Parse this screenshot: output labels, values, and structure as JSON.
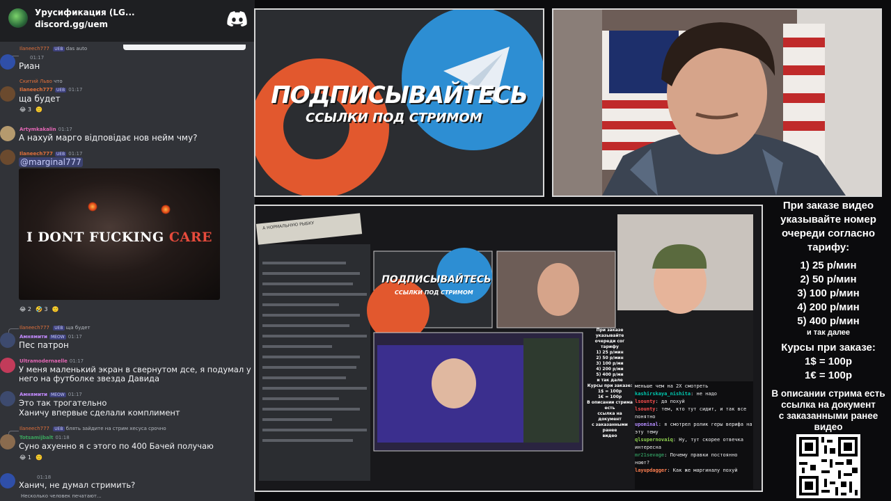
{
  "chat": {
    "server_name": "Урусификация (LG...",
    "server_invite": "discord.gg/uem",
    "typing": "Несколько человек печатают...",
    "messages": [
      {
        "reply_user": "Ilaneech777",
        "reply_badge": "UEB",
        "reply_text": "das auto",
        "user": "",
        "time": "01:17",
        "text": "Риан",
        "reactions": []
      },
      {
        "reply_user": "Скитий Льво",
        "reply_badge": "",
        "reply_text": "что",
        "user": "Ilaneech777",
        "user_color": "#e2703a",
        "badge": "UEB",
        "time": "01:17",
        "text": "ща будет",
        "reactions": [
          "😂 3",
          "🙂"
        ]
      },
      {
        "reply_user": "",
        "user": "Artymkakalin",
        "user_color": "#e266b4",
        "time": "01:17",
        "text": "А нахуй марго відповідає нов нейм чму?",
        "reactions": []
      },
      {
        "reply_user": "",
        "user": "Ilaneech777",
        "user_color": "#e2703a",
        "badge": "UEB",
        "time": "01:17",
        "text": "@marginal777",
        "reactions": [
          "😂 2",
          "🤣 3",
          "🙂"
        ]
      },
      {
        "reply_user": "Ilaneech777",
        "reply_badge": "UEB",
        "reply_text": "ща будет",
        "user": "Амнямити",
        "user_color": "#c48bff",
        "badge": "MEOW",
        "time": "01:17",
        "text": "Пес патрон",
        "reactions": []
      },
      {
        "reply_user": "",
        "user": "Ultramodernaelle",
        "user_color": "#e266b4",
        "time": "01:17",
        "text": "У меня маленький экран в свернутом дсе, я подумал у",
        "text2": "него на футболке звезда Давида",
        "reactions": []
      },
      {
        "reply_user": "",
        "user": "Амнямити",
        "user_color": "#c48bff",
        "badge": "MEOW",
        "time": "01:17",
        "text": "Это так трогательно",
        "text2": "Ханичу впервые сделали комплимент",
        "reactions": []
      },
      {
        "reply_user": "Ilaneech777",
        "reply_badge": "UEB",
        "reply_text": "блять зайдите на стрим хесуса срочно",
        "user": "Totsamijbalt",
        "user_color": "#3ba55d",
        "time": "01:18",
        "text": "Суно ахуенно я с этого по 400 Бачей получаю",
        "reactions": [
          "😂 1",
          "🙂"
        ]
      },
      {
        "reply_user": "",
        "user": "",
        "time": "01:18",
        "text": "Ханич, не думал стримить?",
        "reactions": []
      }
    ],
    "meme": {
      "caption_white": "I DONT FUCKING ",
      "caption_red": "CARE"
    }
  },
  "promo": {
    "title": "ПОДПИСЫВАЙТЕСЬ",
    "subtitle": "ССЫЛКИ ПОД СТРИМОМ"
  },
  "stream": {
    "tape_text": "А НОРМАЛЬНУЮ РЫБКУ",
    "promo_title": "ПОДПИСЫВАЙТЕСЬ",
    "promo_subtitle": "ССЫЛКИ ПОД СТРИМОМ",
    "mini_info": [
      "При заказе",
      "указывайте",
      "очереди сог",
      "тарифу",
      "1) 25 р/мин",
      "2) 50 р/мин",
      "3) 100 р/ми",
      "4) 200 р/ми",
      "5) 400 р/ми",
      "и так дале",
      "Курсы при заказе:",
      "1$ = 100р",
      "1€ = 100р",
      "В описании стрима есть",
      "ссылка на документ",
      "с заказанными ранее",
      "видео"
    ],
    "twitch_chat": [
      {
        "user": "",
        "text": "меньше чем на 2Х смотреть"
      },
      {
        "user": "kashirskaya_nishita",
        "text": "не надо"
      },
      {
        "user": "lsounty",
        "text": "да похуй"
      },
      {
        "user": "lsounty",
        "text": "тем, кто тут сидит, и так все понятно"
      },
      {
        "user": "upominal",
        "text": "я смотрел ролик геры верифа на эту тему"
      },
      {
        "user": "qlsupernovaiq",
        "text": "Ну, тут скорее отвечка интересна"
      },
      {
        "user": "mr21sevage",
        "text": "Почему правки постоянно ноют?"
      },
      {
        "user": "layupdagger",
        "text": "Как же маргиналу похуй"
      }
    ]
  },
  "info": {
    "lines": [
      "При заказе видео",
      "указывайте номер",
      "очереди согласно",
      "тарифу:"
    ],
    "tariffs": [
      "1) 25 р/мин",
      "2) 50 р/мин",
      "3) 100 р/мин",
      "4) 200 р/мин",
      "5) 400 р/мин"
    ],
    "etc": "и так далее",
    "rates_title": "Курсы при заказе:",
    "rates": [
      "1$ = 100р",
      "1€ = 100р"
    ],
    "desc": [
      "В описании стрима есть",
      "ссылка на документ",
      "с заказанными ранее",
      "видео"
    ]
  },
  "colors": {
    "discord_bg": "#313338",
    "boosty": "#e2582e",
    "telegram": "#2d8ed3"
  }
}
